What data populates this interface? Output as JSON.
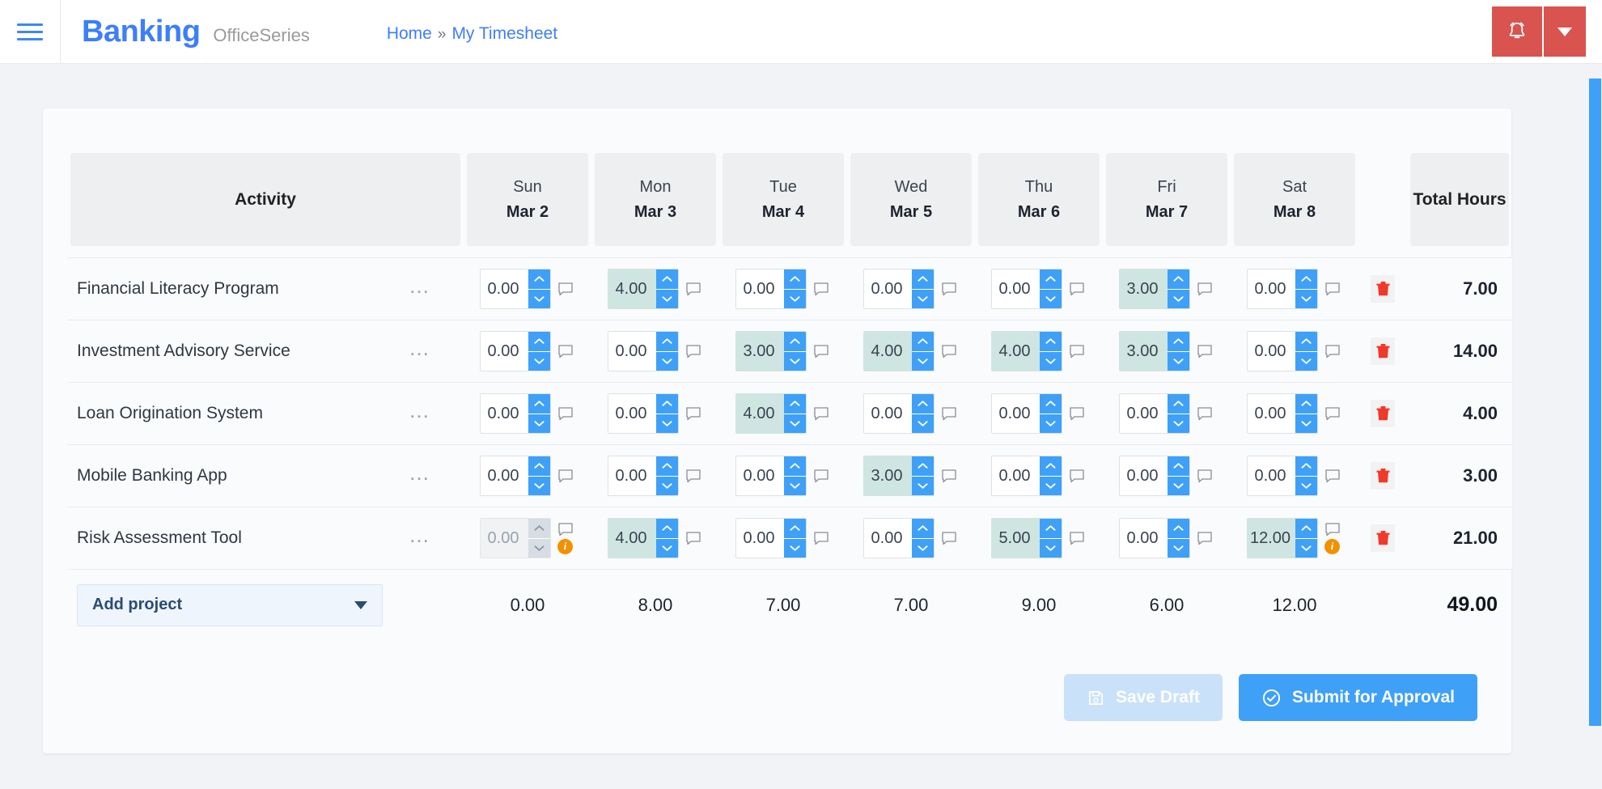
{
  "header": {
    "menu_icon": "hamburger-icon",
    "brand": "Banking",
    "brand_suffix": "OfficeSeries",
    "breadcrumb": {
      "home": "Home",
      "separator": "»",
      "current": "My Timesheet"
    },
    "notification_icon": "bell-icon",
    "notification_caret_icon": "chevron-down-icon",
    "accent_blue": "#3d7ef9",
    "notification_red": "#d9534f"
  },
  "table": {
    "activity_header": "Activity",
    "total_header": "Total Hours",
    "days": [
      {
        "dow": "Sun",
        "date": "Mar 2"
      },
      {
        "dow": "Mon",
        "date": "Mar 3"
      },
      {
        "dow": "Tue",
        "date": "Mar 4"
      },
      {
        "dow": "Wed",
        "date": "Mar 5"
      },
      {
        "dow": "Thu",
        "date": "Mar 6"
      },
      {
        "dow": "Fri",
        "date": "Mar 7"
      },
      {
        "dow": "Sat",
        "date": "Mar 8"
      }
    ],
    "rows": [
      {
        "activity": "Financial Literacy Program",
        "menu_icon": "ellipsis-icon",
        "delete_icon": "trash-icon",
        "total": "7.00",
        "cells": [
          {
            "value": "0.00",
            "filled": false,
            "disabled": false,
            "info": false
          },
          {
            "value": "4.00",
            "filled": true,
            "disabled": false,
            "info": false
          },
          {
            "value": "0.00",
            "filled": false,
            "disabled": false,
            "info": false
          },
          {
            "value": "0.00",
            "filled": false,
            "disabled": false,
            "info": false
          },
          {
            "value": "0.00",
            "filled": false,
            "disabled": false,
            "info": false
          },
          {
            "value": "3.00",
            "filled": true,
            "disabled": false,
            "info": false
          },
          {
            "value": "0.00",
            "filled": false,
            "disabled": false,
            "info": false
          }
        ]
      },
      {
        "activity": "Investment Advisory Service",
        "menu_icon": "ellipsis-icon",
        "delete_icon": "trash-icon",
        "total": "14.00",
        "cells": [
          {
            "value": "0.00",
            "filled": false,
            "disabled": false,
            "info": false
          },
          {
            "value": "0.00",
            "filled": false,
            "disabled": false,
            "info": false
          },
          {
            "value": "3.00",
            "filled": true,
            "disabled": false,
            "info": false
          },
          {
            "value": "4.00",
            "filled": true,
            "disabled": false,
            "info": false
          },
          {
            "value": "4.00",
            "filled": true,
            "disabled": false,
            "info": false
          },
          {
            "value": "3.00",
            "filled": true,
            "disabled": false,
            "info": false
          },
          {
            "value": "0.00",
            "filled": false,
            "disabled": false,
            "info": false
          }
        ]
      },
      {
        "activity": "Loan Origination System",
        "menu_icon": "ellipsis-icon",
        "delete_icon": "trash-icon",
        "total": "4.00",
        "cells": [
          {
            "value": "0.00",
            "filled": false,
            "disabled": false,
            "info": false
          },
          {
            "value": "0.00",
            "filled": false,
            "disabled": false,
            "info": false
          },
          {
            "value": "4.00",
            "filled": true,
            "disabled": false,
            "info": false
          },
          {
            "value": "0.00",
            "filled": false,
            "disabled": false,
            "info": false
          },
          {
            "value": "0.00",
            "filled": false,
            "disabled": false,
            "info": false
          },
          {
            "value": "0.00",
            "filled": false,
            "disabled": false,
            "info": false
          },
          {
            "value": "0.00",
            "filled": false,
            "disabled": false,
            "info": false
          }
        ]
      },
      {
        "activity": "Mobile Banking App",
        "menu_icon": "ellipsis-icon",
        "delete_icon": "trash-icon",
        "total": "3.00",
        "cells": [
          {
            "value": "0.00",
            "filled": false,
            "disabled": false,
            "info": false
          },
          {
            "value": "0.00",
            "filled": false,
            "disabled": false,
            "info": false
          },
          {
            "value": "0.00",
            "filled": false,
            "disabled": false,
            "info": false
          },
          {
            "value": "3.00",
            "filled": true,
            "disabled": false,
            "info": false
          },
          {
            "value": "0.00",
            "filled": false,
            "disabled": false,
            "info": false
          },
          {
            "value": "0.00",
            "filled": false,
            "disabled": false,
            "info": false
          },
          {
            "value": "0.00",
            "filled": false,
            "disabled": false,
            "info": false
          }
        ]
      },
      {
        "activity": "Risk Assessment Tool",
        "menu_icon": "ellipsis-icon",
        "delete_icon": "trash-icon",
        "total": "21.00",
        "cells": [
          {
            "value": "0.00",
            "filled": false,
            "disabled": true,
            "info": true
          },
          {
            "value": "4.00",
            "filled": true,
            "disabled": false,
            "info": false
          },
          {
            "value": "0.00",
            "filled": false,
            "disabled": false,
            "info": false
          },
          {
            "value": "0.00",
            "filled": false,
            "disabled": false,
            "info": false
          },
          {
            "value": "5.00",
            "filled": true,
            "disabled": false,
            "info": false
          },
          {
            "value": "0.00",
            "filled": false,
            "disabled": false,
            "info": false
          },
          {
            "value": "12.00",
            "filled": true,
            "disabled": false,
            "info": true
          }
        ]
      }
    ],
    "footer": {
      "add_project_label": "Add project",
      "add_project_caret_icon": "chevron-down-icon",
      "day_totals": [
        "0.00",
        "8.00",
        "7.00",
        "7.00",
        "9.00",
        "6.00",
        "12.00"
      ],
      "grand_total": "49.00"
    }
  },
  "actions": {
    "save_draft_label": "Save Draft",
    "save_draft_icon": "save-icon",
    "save_draft_disabled": true,
    "submit_label": "Submit for Approval",
    "submit_icon": "check-circle-icon"
  },
  "colors": {
    "filled_cell": "#cfe5e1",
    "spinner_blue": "#3fa0f7",
    "info_orange": "#f29100",
    "delete_red": "#f0392b"
  }
}
